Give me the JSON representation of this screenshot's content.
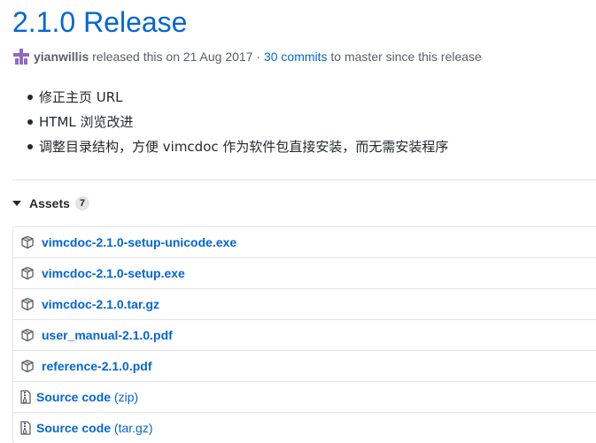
{
  "release": {
    "title": "2.1.0 Release",
    "author": "yianwillis",
    "released_text": " released this on 21 Aug 2017 · ",
    "commits_link": "30 commits",
    "commits_suffix": " to master since this release"
  },
  "notes": [
    "修正主页 URL",
    "HTML 浏览改进",
    "调整目录结构，方便 vimcdoc 作为软件包直接安装，而无需安装程序"
  ],
  "assets": {
    "label": "Assets",
    "count": "7",
    "files": [
      {
        "name": "vimcdoc-2.1.0-setup-unicode.exe",
        "icon": "package-icon"
      },
      {
        "name": "vimcdoc-2.1.0-setup.exe",
        "icon": "package-icon"
      },
      {
        "name": "vimcdoc-2.1.0.tar.gz",
        "icon": "package-icon"
      },
      {
        "name": "user_manual-2.1.0.pdf",
        "icon": "package-icon"
      },
      {
        "name": "reference-2.1.0.pdf",
        "icon": "package-icon"
      }
    ],
    "source": [
      {
        "label": "Source code",
        "format": "(zip)",
        "icon": "file-zip-icon"
      },
      {
        "label": "Source code",
        "format": "(tar.gz)",
        "icon": "file-zip-icon"
      }
    ]
  },
  "colors": {
    "link": "#0366d6",
    "text": "#24292e",
    "muted": "#586069",
    "border": "#e1e4e8",
    "avatar": "#8e6cc2"
  }
}
